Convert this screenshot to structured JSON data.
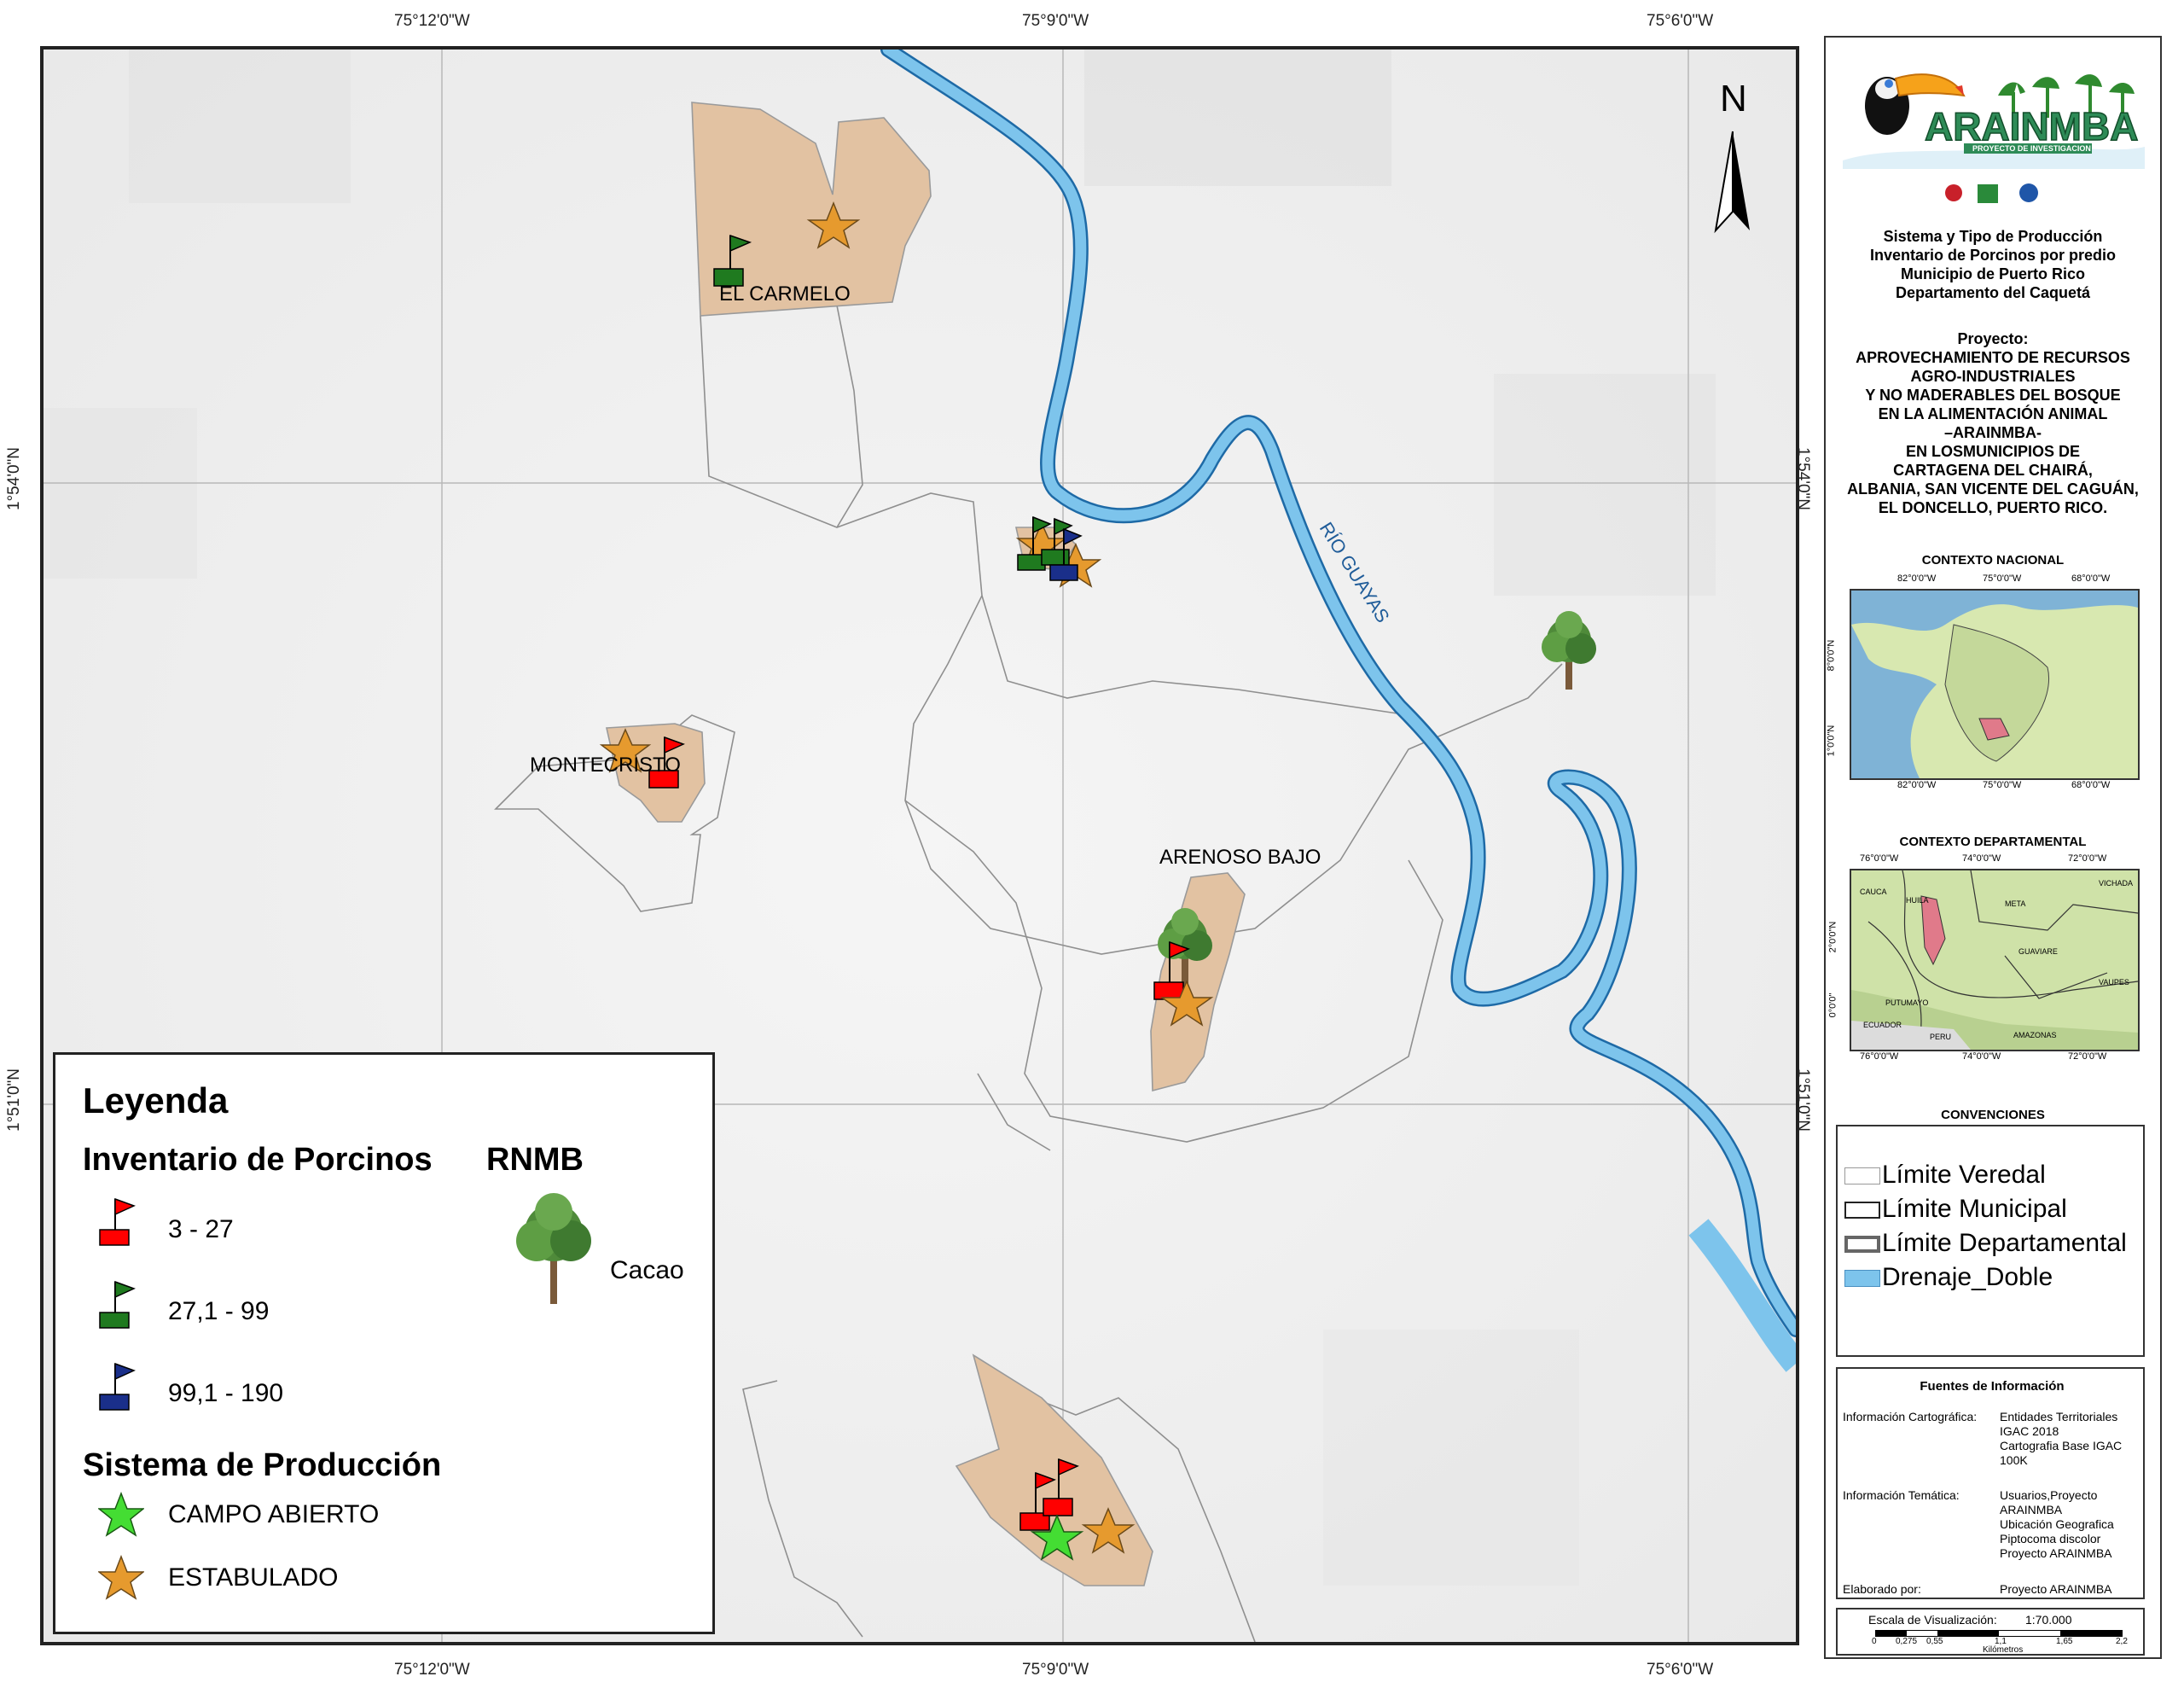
{
  "map": {
    "coords_top": [
      "75°12'0\"W",
      "75°9'0\"W",
      "75°6'0\"W"
    ],
    "coords_bottom": [
      "75°12'0\"W",
      "75°9'0\"W",
      "75°6'0\"W"
    ],
    "coords_left": [
      "1°54'0\"N",
      "1°51'0\"N"
    ],
    "coords_right": [
      "1°54'0\"N",
      "1°51'0\"N"
    ],
    "north_label": "N",
    "river_label": "RÍO GUAYAS",
    "place_labels": {
      "el_carmelo": "EL CARMELO",
      "montecristo": "MONTECRISTO",
      "arenoso_bajo": "ARENOSO BAJO"
    },
    "colors": {
      "vereda_fill": "#e2c2a2",
      "river": "#7dc4ec",
      "flag_red": "#ff0000",
      "flag_green": "#1f7a1f",
      "flag_blue": "#1a2f8a",
      "star_orange": "#e69a2e",
      "star_green": "#44dd33"
    }
  },
  "legend": {
    "title": "Leyenda",
    "inventory_title": "Inventario de Porcinos",
    "rnmb_title": "RNMB",
    "rnmb_item": "Cacao",
    "inventory_items": [
      {
        "label": "3 - 27",
        "color": "#ff0000"
      },
      {
        "label": "27,1 - 99",
        "color": "#1f7a1f"
      },
      {
        "label": "99,1 - 190",
        "color": "#1a2f8a"
      }
    ],
    "production_title": "Sistema de Producción",
    "production_items": [
      {
        "label": "CAMPO ABIERTO",
        "icon": "green-star-icon"
      },
      {
        "label": "ESTABULADO",
        "icon": "orange-star-icon"
      }
    ]
  },
  "panel": {
    "logo_text": "ARAINMBA",
    "logo_subtitle": "PROYECTO DE INVESTIGACION",
    "title_lines": [
      "Sistema y Tipo de Producción",
      "Inventario de Porcinos por predio",
      "Municipio de Puerto Rico",
      "Departamento del Caquetá"
    ],
    "project_lines": [
      "Proyecto:",
      "APROVECHAMIENTO DE RECURSOS",
      "AGRO-INDUSTRIALES",
      "Y NO MADERABLES DEL BOSQUE",
      "EN LA ALIMENTACIÓN ANIMAL",
      "–ARAINMBA-",
      "EN LOSMUNICIPIOS DE",
      "CARTAGENA DEL CHAIRÁ,",
      "ALBANIA, SAN VICENTE DEL CAGUÁN,",
      "EL DONCELLO, PUERTO RICO."
    ],
    "contexto_nacional": "CONTEXTO NACIONAL",
    "nacional_coords_top": [
      "82°0'0\"W",
      "75°0'0\"W",
      "68°0'0\"W"
    ],
    "nacional_coords_bottom": [
      "82°0'0\"W",
      "75°0'0\"W",
      "68°0'0\"W"
    ],
    "nacional_coords_side": [
      "8°0'0\"N",
      "1°0'0\"N"
    ],
    "contexto_departamental": "CONTEXTO DEPARTAMENTAL",
    "depto_coords_top": [
      "76°0'0\"W",
      "74°0'0\"W",
      "72°0'0\"W"
    ],
    "depto_coords_bottom": [
      "76°0'0\"W",
      "74°0'0\"W",
      "72°0'0\"W"
    ],
    "depto_coords_side": [
      "2°0'0\"N",
      "0°0'0\""
    ],
    "depto_names": {
      "meta": "META",
      "guaviare": "GUAVIARE",
      "vaupes": "VAUPES",
      "putumayo": "PUTUMAYO",
      "amazonas": "AMAZONAS",
      "peru": "PERU",
      "ecuador": "ECUADOR",
      "huila": "HUILA",
      "cauca": "CAUCA",
      "vichada": "VICHADA"
    },
    "convenciones_title": "CONVENCIONES",
    "convenciones": [
      {
        "label": "Límite Veredal",
        "style": "thin"
      },
      {
        "label": "Límite Municipal",
        "style": "medium"
      },
      {
        "label": "Límite Departamental",
        "style": "thick"
      },
      {
        "label": "Drenaje_Doble",
        "style": "water"
      }
    ],
    "fuentes_title": "Fuentes de Información",
    "fuentes": [
      {
        "key": "Información Cartográfica:",
        "values": [
          "Entidades Territoriales",
          "IGAC 2018",
          "Cartografia Base IGAC",
          "100K"
        ]
      },
      {
        "key": "Información Temática:",
        "values": [
          "Usuarios,Proyecto",
          "ARAINMBA",
          "Ubicación Geografica",
          "Piptocoma discolor",
          "Proyecto ARAINMBA"
        ]
      },
      {
        "key": "Elaborado por:",
        "values": [
          "Proyecto ARAINMBA"
        ]
      }
    ],
    "scale_label": "Escala de Visualización:",
    "scale_value": "1:70.000",
    "scale_ticks": [
      "0",
      "0,275",
      "0,55",
      "1,1",
      "1,65",
      "2,2"
    ],
    "scale_unit": "Kilómetros"
  }
}
